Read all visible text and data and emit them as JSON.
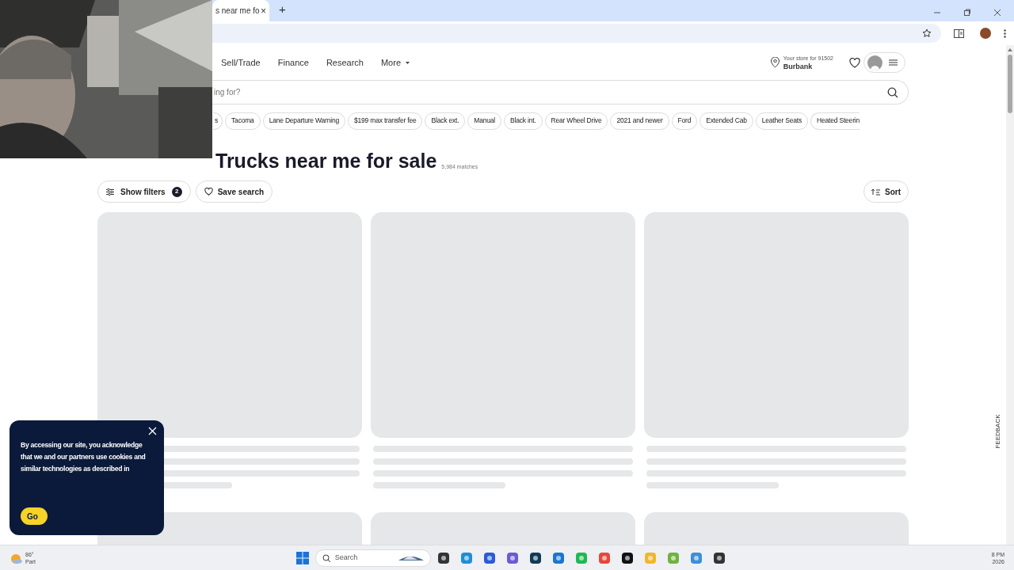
{
  "browser": {
    "tab_title": "s near me fo",
    "tab_close": "×",
    "new_tab": "+"
  },
  "nav": {
    "links": [
      "Sell/Trade",
      "Finance",
      "Research",
      "More"
    ],
    "store_label": "Your store for 91502",
    "store_name": "Burbank"
  },
  "search": {
    "placeholder": "ing for?"
  },
  "chips": [
    "s",
    "Tacoma",
    "Lane Departure Warning",
    "$199 max transfer fee",
    "Black ext.",
    "Manual",
    "Black int.",
    "Rear Wheel Drive",
    "2021 and newer",
    "Ford",
    "Extended Cab",
    "Leather Seats",
    "Heated Steerin"
  ],
  "heading": "Trucks near me for sale",
  "matches": "5,984 matches",
  "toolbar": {
    "filters": "Show filters",
    "filter_count": "2",
    "save": "Save search",
    "sort": "Sort"
  },
  "cards": [
    {
      "kind": "skeleton"
    },
    {
      "kind": "skeleton"
    },
    {
      "kind": "skeleton"
    },
    {
      "kind": "cut"
    },
    {
      "kind": "cut"
    },
    {
      "kind": "cut"
    }
  ],
  "cookie_banner": {
    "text": "By accessing our site, you acknowledge that we and our partners use cookies and similar technologies as described in",
    "button": "Go"
  },
  "feedback": "FEEDBACK",
  "taskbar": {
    "weather_temp": "86°",
    "weather_text": "Part",
    "search": "Search",
    "clock_time": "8 PM",
    "clock_date": "2026"
  }
}
